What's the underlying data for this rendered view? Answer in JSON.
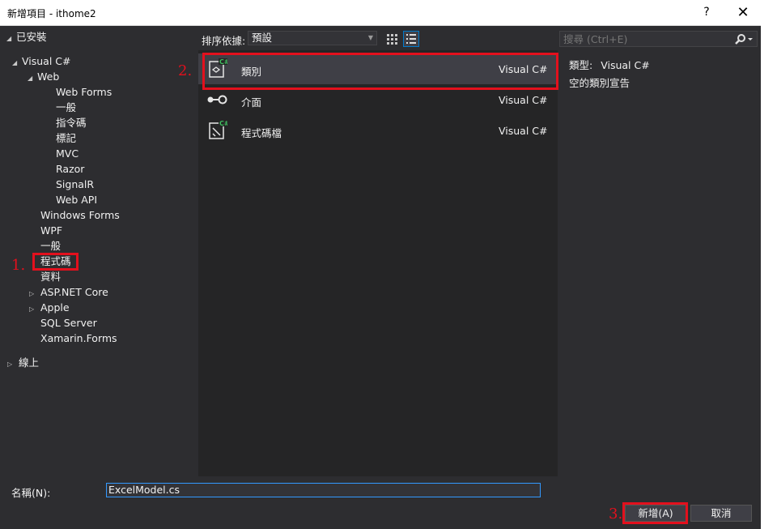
{
  "window": {
    "title": "新增項目 - ithome2",
    "help_label": "?",
    "close_label": "✕"
  },
  "tree": {
    "installed": "已安裝",
    "visual_csharp": "Visual C#",
    "web": "Web",
    "web_children": [
      "Web Forms",
      "一般",
      "指令碼",
      "標記",
      "MVC",
      "Razor",
      "SignalR",
      "Web API"
    ],
    "windows_forms": "Windows Forms",
    "wpf": "WPF",
    "general": "一般",
    "code": "程式碼",
    "data": "資料",
    "aspnet_core": "ASP.NET Core",
    "apple": "Apple",
    "sql_server": "SQL Server",
    "xamarin_forms": "Xamarin.Forms",
    "online": "線上"
  },
  "toolbar": {
    "sort_label": "排序依據:",
    "sort_value": "預設"
  },
  "search": {
    "placeholder": "搜尋 (Ctrl+E)"
  },
  "templates": [
    {
      "name": "類別",
      "lang": "Visual C#",
      "icon": "class-icon",
      "selected": true
    },
    {
      "name": "介面",
      "lang": "Visual C#",
      "icon": "interface-icon",
      "selected": false
    },
    {
      "name": "程式碼檔",
      "lang": "Visual C#",
      "icon": "code-file-icon",
      "selected": false
    }
  ],
  "details": {
    "type_label": "類型:",
    "type_value": "Visual C#",
    "description": "空的類別宣告"
  },
  "footer": {
    "name_label": "名稱(N):",
    "name_value": "ExcelModel.cs",
    "add_label": "新增(A)",
    "cancel_label": "取消"
  },
  "annotations": {
    "step1": "1.",
    "step2": "2.",
    "step3": "3."
  },
  "colors": {
    "background": "#2d2d30",
    "panel": "#252526",
    "selected": "#3f3f46",
    "highlight": "#e3101d",
    "accent": "#007acc"
  }
}
